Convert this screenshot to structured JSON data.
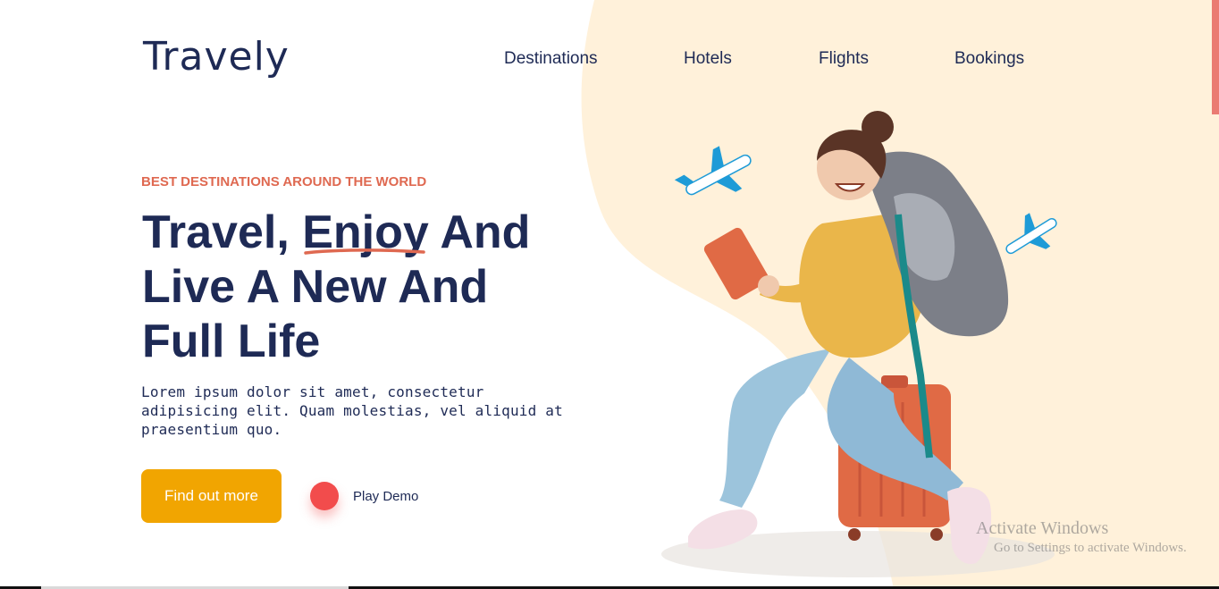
{
  "brand": {
    "logo": "Travely"
  },
  "nav": {
    "items": [
      {
        "label": "Destinations"
      },
      {
        "label": "Hotels"
      },
      {
        "label": "Flights"
      },
      {
        "label": "Bookings"
      }
    ]
  },
  "hero": {
    "eyebrow": "BEST DESTINATIONS AROUND THE WORLD",
    "headline": {
      "line1_part1": "Travel, ",
      "line1_highlight": "Enjoy",
      "line1_part2": " And",
      "line2": "Live A New And",
      "line3": "Full Life"
    },
    "description": "Lorem ipsum dolor sit amet, consectetur adipisicing elit. Quam molestias, vel aliquid at praesentium quo.",
    "cta_label": "Find out more",
    "play_label": "Play Demo"
  },
  "watermark": {
    "title": "Activate Windows",
    "subtitle": "Go to Settings to activate Windows."
  },
  "colors": {
    "accent_orange": "#f1a501",
    "eyebrow_red": "#df6951",
    "play_red": "#f24c4c",
    "navy": "#1e2a55",
    "blob_cream": "#fff1da",
    "plane_blue": "#1e9bd7"
  }
}
